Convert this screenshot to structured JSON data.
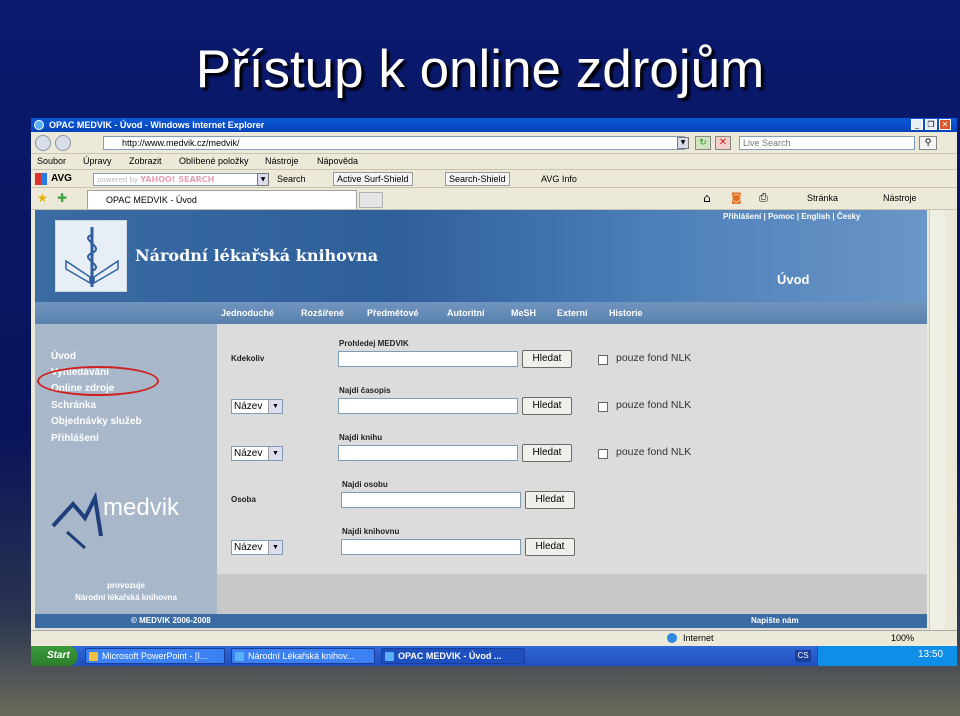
{
  "slide": {
    "title": "Přístup k online zdrojům"
  },
  "window": {
    "title": "OPAC MEDVIK - Úvod - Windows Internet Explorer"
  },
  "address": {
    "url": "http://www.medvik.cz/medvik/",
    "search_placeholder": "Live Search"
  },
  "menu": [
    "Soubor",
    "Úpravy",
    "Zobrazit",
    "Oblíbené položky",
    "Nástroje",
    "Nápověda"
  ],
  "toolbar": {
    "avg": "AVG",
    "powered_by": "powered by",
    "yahoo": "YAHOO! SEARCH",
    "search": "Search",
    "active_surf": "Active Surf-Shield",
    "search_shield": "Search-Shield",
    "avg_info": "AVG Info"
  },
  "tab": {
    "label": "OPAC MEDVIK - Úvod"
  },
  "command_bar": {
    "page": "Stránka",
    "tools": "Nástroje"
  },
  "site": {
    "name": "Národní lékařská knihovna",
    "top_links": [
      "Přihlášení",
      "Pomoc",
      "English",
      "Česky"
    ],
    "section_title": "Úvod",
    "tabs": [
      "Jednoduché",
      "Rozšířené",
      "Předmětové",
      "Autoritní",
      "MeSH",
      "Externí",
      "Historie"
    ],
    "sidebar": [
      "Úvod",
      "Vyhledávání",
      "Online zdroje",
      "Schránka",
      "Objednávky služeb",
      "Přihlášení"
    ],
    "logo": "medvik",
    "operated_by": [
      "provozuje",
      "Národní lékařská knihovna"
    ],
    "footer_left": "© MEDVIK 2006-2008",
    "footer_right": "Napište nám"
  },
  "search_rows": [
    {
      "left": "Kdekoliv",
      "title": "Prohledej MEDVIK",
      "button": "Hledat",
      "check": "pouze fond NLK"
    },
    {
      "left": "Název",
      "title": "Najdi časopis",
      "button": "Hledat",
      "check": "pouze fond NLK"
    },
    {
      "left": "Název",
      "title": "Najdi knihu",
      "button": "Hledat",
      "check": "pouze fond NLK"
    },
    {
      "left": "Osoba",
      "title": "Najdi osobu",
      "button": "Hledat"
    },
    {
      "left": "Název",
      "title": "Najdi knihovnu",
      "button": "Hledat"
    }
  ],
  "status": {
    "zone": "Internet",
    "zoom": "100%"
  },
  "taskbar": {
    "start": "Start",
    "items": [
      "Microsoft PowerPoint - [I...",
      "Národní Lékařská knihov...",
      "OPAC MEDVIK - Úvod ..."
    ],
    "lang": "CS",
    "clock": "13:50"
  }
}
